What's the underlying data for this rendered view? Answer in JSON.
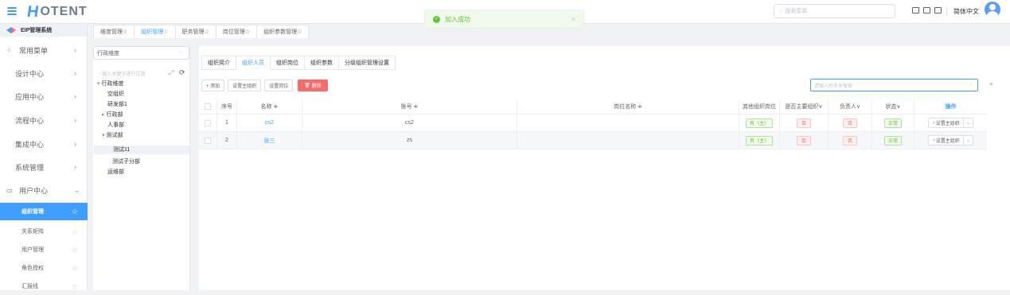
{
  "header": {
    "logo_text": "OTENT",
    "search_placeholder": "搜索菜单",
    "language": "简体中文"
  },
  "toast": {
    "message": "加入成功",
    "close": "×"
  },
  "sidebar": {
    "system_title": "EIP管理系统",
    "nav": [
      {
        "label": "常用菜单",
        "icon": "grid-icon"
      },
      {
        "label": "设计中心"
      },
      {
        "label": "应用中心"
      },
      {
        "label": "流程中心"
      },
      {
        "label": "集成中心"
      },
      {
        "label": "系统管理"
      },
      {
        "label": "用户中心",
        "icon": "monitor-icon"
      }
    ],
    "sub_items": [
      "组织管理",
      "关系矩阵",
      "用户管理",
      "角色授权",
      "汇报线"
    ]
  },
  "top_tabs": [
    "维度管理☆",
    "组织管理☆",
    "职务管理☆",
    "岗位管理☆",
    "组织参数管理☆"
  ],
  "tree": {
    "dimension_select": "行政维度",
    "filter_placeholder": "输入关键字进行过滤",
    "nodes": [
      {
        "label": "行政维度",
        "prefix": "▾"
      },
      {
        "label": "空组织",
        "prefix": ""
      },
      {
        "label": "研发部1",
        "prefix": ""
      },
      {
        "label": "行政部",
        "prefix": "▸"
      },
      {
        "label": "人事部",
        "prefix": ""
      },
      {
        "label": "测试部",
        "prefix": "▾"
      },
      {
        "label": "测试11",
        "prefix": ""
      },
      {
        "label": "测试子分部",
        "prefix": ""
      },
      {
        "label": "运维部",
        "prefix": ""
      }
    ]
  },
  "inner_tabs": [
    "组织简介",
    "组织人员",
    "组织岗位",
    "组织参数",
    "分级组织管理设置"
  ],
  "toolbar": {
    "add": "+ 添加",
    "set_main_org": "设置主组织",
    "set_post": "设置岗位",
    "delete": "删除",
    "name_search_placeholder": "请输入姓名来搜索"
  },
  "table": {
    "headers": [
      "序号",
      "名称 ≑",
      "账号 ≑",
      "岗位名称 ≑",
      "其他组织岗位",
      "是否主要组织∨",
      "负责人∨",
      "状态∨",
      "操作"
    ],
    "rows": [
      {
        "index": "1",
        "name": "cs2",
        "account": "cs2",
        "post": "",
        "other_post": "有（主）",
        "is_main": "否",
        "is_manager": "否",
        "status": "正常",
        "action": "设置主组织"
      },
      {
        "index": "2",
        "name": "张三",
        "account": "zs",
        "post": "",
        "other_post": "有（主）",
        "is_main": "否",
        "is_manager": "否",
        "status": "正常",
        "action": "设置主组织"
      }
    ]
  },
  "colors": {
    "primary": "#409eff",
    "danger": "#f56c6c",
    "success": "#67c23a"
  }
}
